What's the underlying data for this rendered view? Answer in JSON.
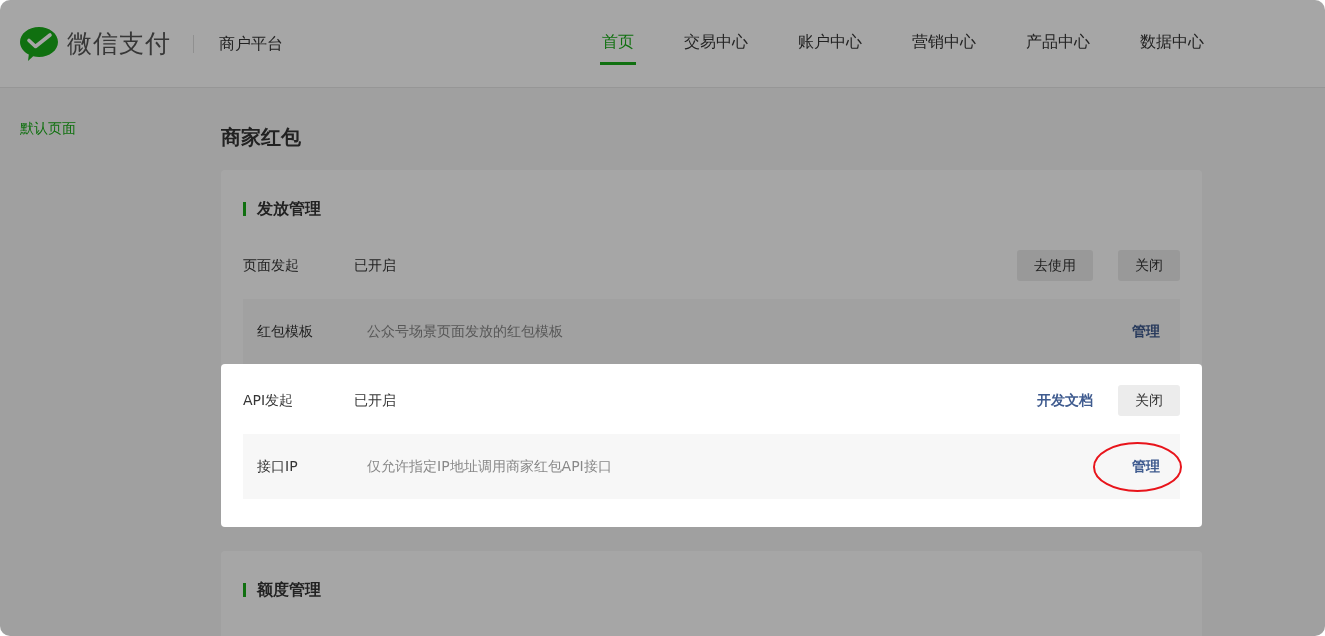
{
  "header": {
    "brand": "微信支付",
    "platform": "商户平台",
    "nav": [
      {
        "label": "首页",
        "selected": true
      },
      {
        "label": "交易中心",
        "selected": false
      },
      {
        "label": "账户中心",
        "selected": false
      },
      {
        "label": "营销中心",
        "selected": false
      },
      {
        "label": "产品中心",
        "selected": false
      },
      {
        "label": "数据中心",
        "selected": false
      }
    ]
  },
  "sidebar": {
    "items": [
      {
        "label": "默认页面",
        "selected": true
      }
    ]
  },
  "page_title": "商家红包",
  "sections": [
    {
      "title": "发放管理",
      "groups": [
        {
          "label": "页面发起",
          "status": "已开启",
          "highlighted": false,
          "actions": [
            {
              "kind": "button",
              "label": "去使用"
            },
            {
              "kind": "button",
              "label": "关闭"
            }
          ],
          "items": [
            {
              "label": "红包模板",
              "description": "公众号场景页面发放的红包模板",
              "action": "管理",
              "circled": false
            }
          ]
        },
        {
          "label": "API发起",
          "status": "已开启",
          "highlighted": true,
          "actions": [
            {
              "kind": "link",
              "label": "开发文档"
            },
            {
              "kind": "button",
              "label": "关闭"
            }
          ],
          "items": [
            {
              "label": "接口IP",
              "description": "仅允许指定IP地址调用商家红包API接口",
              "action": "管理",
              "circled": true
            }
          ]
        }
      ]
    },
    {
      "title": "额度管理"
    }
  ]
}
